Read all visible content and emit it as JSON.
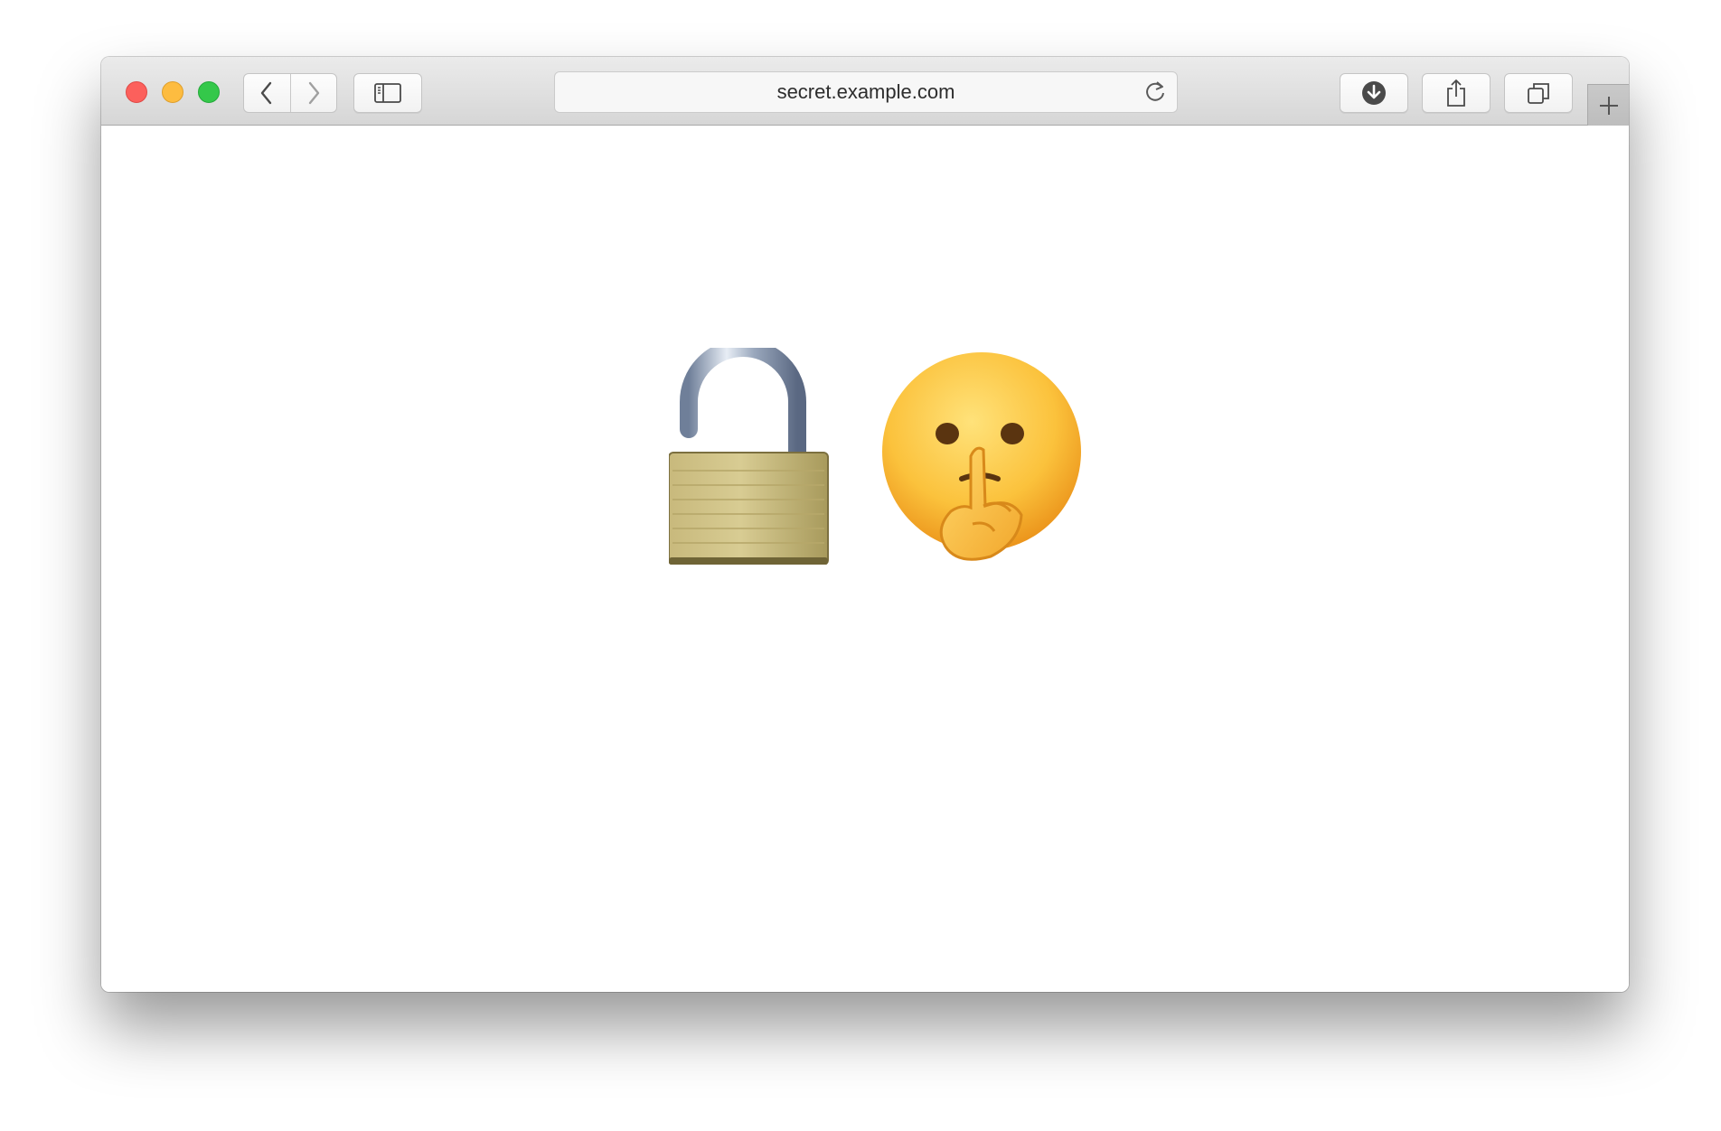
{
  "window": {
    "traffic_lights": {
      "close_color": "#fc605c",
      "minimize_color": "#fdbc40",
      "zoom_color": "#34c84a"
    },
    "toolbar": {
      "back_icon": "chevron-left-icon",
      "forward_icon": "chevron-right-icon",
      "sidebar_icon": "sidebar-icon",
      "reload_icon": "reload-icon",
      "downloads_icon": "download-icon",
      "share_icon": "share-icon",
      "tabs_icon": "tab-overview-icon",
      "new_tab_icon": "plus-icon"
    },
    "address_bar": {
      "url": "secret.example.com"
    }
  },
  "page": {
    "emojis": [
      {
        "name": "open-lock-icon",
        "glyph": "🔓"
      },
      {
        "name": "shushing-face-icon",
        "glyph": "🤫"
      }
    ]
  }
}
